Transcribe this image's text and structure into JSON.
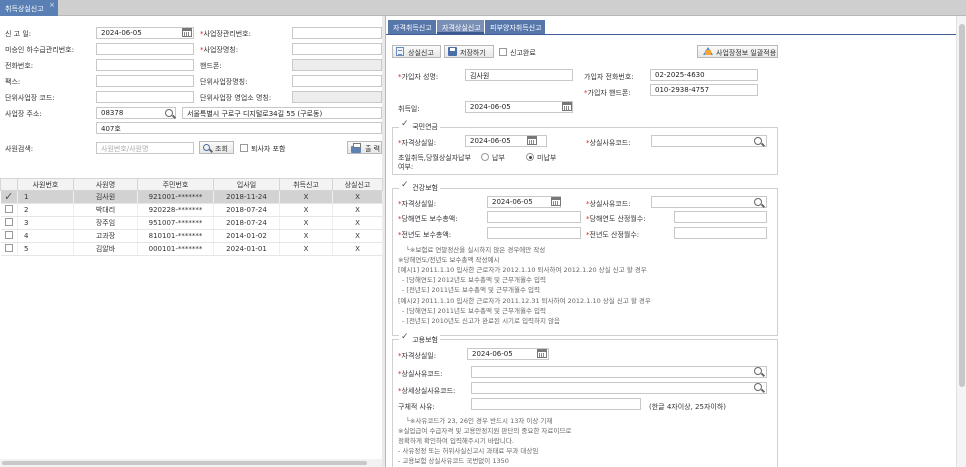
{
  "top_tab": {
    "label": "취득상실신고",
    "close": "×"
  },
  "left": {
    "report_date_label": "신 고 일:",
    "report_date": "2024-06-05",
    "biz_mgmt_no_label": "사업장관리번호:",
    "sewage_no_label": "미승인 하수급관리번호:",
    "biz_name_label": "사업장명칭:",
    "phone_label": "전화번호:",
    "mobile_label": "핸드폰:",
    "fax_label": "팩스:",
    "unit_biz_name_label": "단위사업장명칭:",
    "unit_biz_code_label": "단위사업장 코드:",
    "unit_biz_office_label": "단위사업장 영업소 명칭:",
    "biz_addr_label": "사업장 주소:",
    "zip": "08378",
    "addr1": "서울특별시 구로구 디지털로34길 55 (구로동)",
    "addr2": "407호",
    "search_label": "사원검색:",
    "search_placeholder": "사원번호/사원명",
    "search_btn": "조회",
    "retired_label": "퇴사자 포함",
    "print_btn": "출 력",
    "columns": [
      "",
      "사원번호",
      "사원명",
      "주민번호",
      "입사일",
      "취득신고",
      "상실신고"
    ],
    "rows": [
      {
        "no": "1",
        "name": "김사원",
        "rrn": "921001-*******",
        "date": "2018-11-24",
        "acq": "X",
        "loss": "X",
        "checked": true
      },
      {
        "no": "2",
        "name": "박대리",
        "rrn": "920228-*******",
        "date": "2018-07-24",
        "acq": "X",
        "loss": "X",
        "checked": false
      },
      {
        "no": "3",
        "name": "장주임",
        "rrn": "951007-*******",
        "date": "2018-07-24",
        "acq": "X",
        "loss": "X",
        "checked": false
      },
      {
        "no": "4",
        "name": "고과장",
        "rrn": "810101-*******",
        "date": "2014-01-02",
        "acq": "X",
        "loss": "X",
        "checked": false
      },
      {
        "no": "5",
        "name": "김알바",
        "rrn": "000101-*******",
        "date": "2024-01-01",
        "acq": "X",
        "loss": "X",
        "checked": false
      }
    ]
  },
  "right": {
    "tabs": [
      "자격취득신고",
      "자격상실신고",
      "피부양자취득신고"
    ],
    "btn_report": "상실신고",
    "btn_save": "저장하기",
    "report_done": "신고완료",
    "btn_apply": "사업장정보 일괄적용",
    "subscriber_name_label": "가입자 성명:",
    "subscriber_name": "김사원",
    "subscriber_phone_label": "가입자 전화번호:",
    "subscriber_phone": "02-2025-4630",
    "subscriber_mobile_label": "가입자 핸드폰:",
    "subscriber_mobile": "010-2938-4757",
    "acq_date_label": "취득일:",
    "acq_date": "2024-06-05",
    "pension": {
      "title": "국민연금",
      "loss_date_label": "자격상실일:",
      "loss_date": "2024-06-05",
      "reason_label": "상실사유코드:",
      "first_label1": "초일취득,당월상실자납부",
      "first_label2": "여부:",
      "opt_pay": "납부",
      "opt_nopay": "미납부"
    },
    "health": {
      "title": "건강보험",
      "loss_date_label": "자격상실일:",
      "loss_date": "2024-06-05",
      "reason_label": "상실사유코드:",
      "cur_total_label": "당해연도 보수총액:",
      "cur_months_label": "당해연도 산정월수:",
      "prev_total_label": "전년도 보수총액:",
      "prev_months_label": "전년도 산정월수:",
      "notes": [
        "└※보험료 연말정산을 실시하지 않은 경우에만 작성",
        "※당해연도/전년도 보수총액 작성예시",
        "[예시1] 2011.1.10 입사한 근로자가 2012.1.10 퇴사하여 2012.1.20 상실 신고 할 경우",
        "  - [당해연도] 2012년도 보수총액 및 근무개월수 입력",
        "  - [전년도] 2011년도 보수총액 및 근무개월수 입력",
        "[예시2] 2011.1.10 입사한 근로자가 2011.12.31 퇴사하여 2012.1.10 상실 신고 할 경우",
        "  - [당해연도] 2011년도 보수총액 및 근무개월수 입력",
        "  - [전년도] 2010년도 신고가 완료된 시기로 입력하지 않음"
      ]
    },
    "employment": {
      "title": "고용보험",
      "loss_date_label": "자격상실일:",
      "loss_date": "2024-06-05",
      "reason_label": "상실사유코드:",
      "detail_reason_label": "상세상실사유코드:",
      "specific_label": "구체적 사유:",
      "specific_hint": "(한글 4자이상, 25자이하)",
      "notes": [
        "└※사유코드가 23, 26인 경우 반드시 13자 이상 기재",
        "※실업급여 수급자격 및 고용안정지원 판단의 중요한 자료이므로",
        "  정확하게 확인하여 입력해주시기 바랍니다.",
        "  - 사유정정 또는 허위사실신고시 과태료 부과 대상임",
        "  - 고용보험 상실사유코드 국번없이 1350"
      ]
    }
  }
}
